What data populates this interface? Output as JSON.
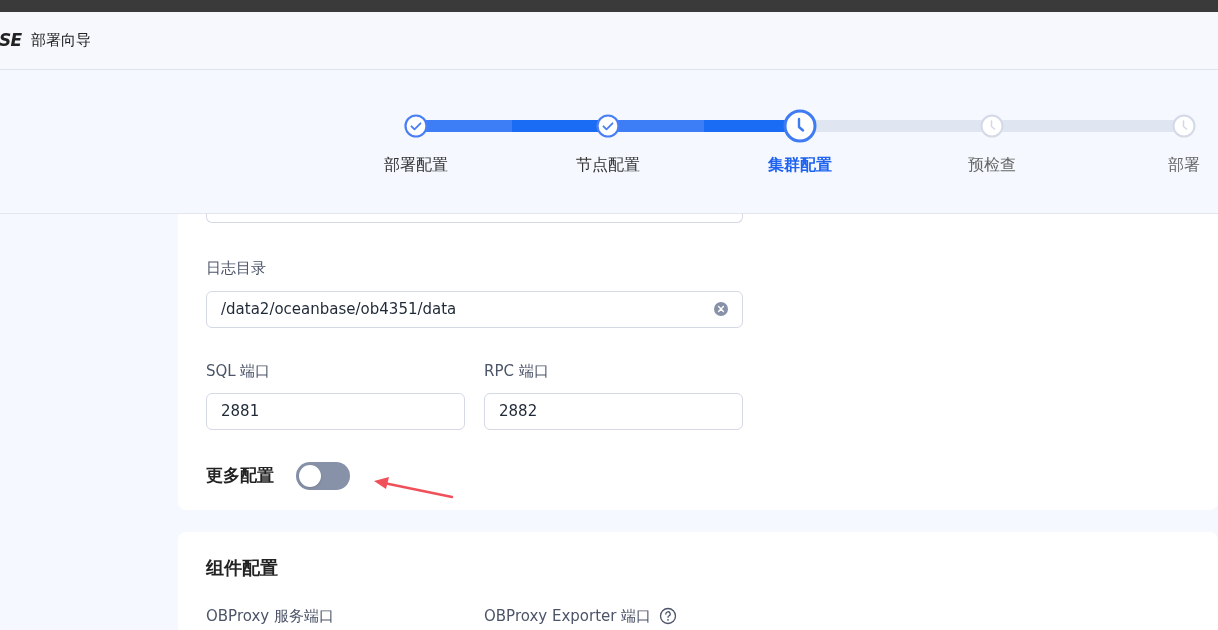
{
  "header": {
    "logo_text": "SE",
    "title": "部署向导"
  },
  "steps": [
    {
      "label": "部署配置",
      "kind": "done"
    },
    {
      "label": "节点配置",
      "kind": "done"
    },
    {
      "label": "集群配置",
      "kind": "current"
    },
    {
      "label": "预检查",
      "kind": "pending"
    },
    {
      "label": "部署",
      "kind": "pending"
    }
  ],
  "cluster_card": {
    "log_dir": {
      "label": "日志目录",
      "value": "/data2/oceanbase/ob4351/data"
    },
    "sql_port": {
      "label": "SQL 端口",
      "value": "2881"
    },
    "rpc_port": {
      "label": "RPC 端口",
      "value": "2882"
    },
    "more_config": {
      "label": "更多配置",
      "on": false
    }
  },
  "component_card": {
    "title": "组件配置",
    "fields": [
      {
        "label": "OBProxy 服务端口",
        "help": false
      },
      {
        "label": "OBProxy Exporter 端口",
        "help": true
      }
    ]
  }
}
